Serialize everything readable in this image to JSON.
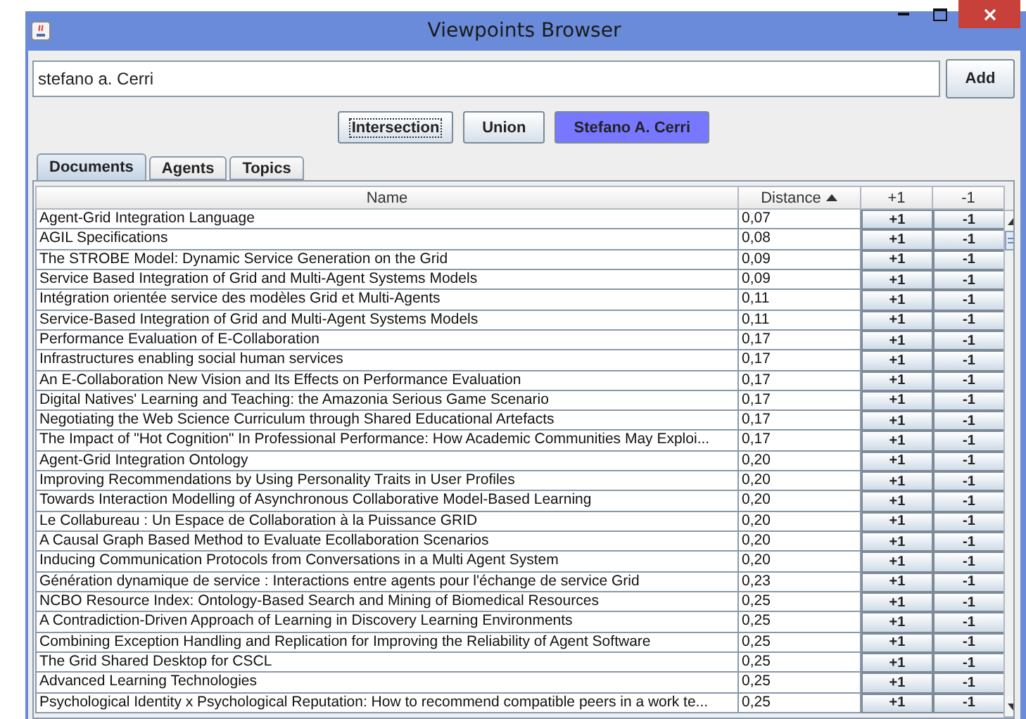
{
  "window": {
    "title": "Viewpoints Browser"
  },
  "search": {
    "value": "stefano a. Cerri",
    "button": "Add"
  },
  "modes": [
    {
      "label": "Intersection",
      "selected": false,
      "focused": true
    },
    {
      "label": "Union",
      "selected": false,
      "focused": false
    },
    {
      "label": "Stefano A. Cerri",
      "selected": true,
      "focused": false
    }
  ],
  "tabs": [
    {
      "label": "Documents",
      "selected": true
    },
    {
      "label": "Agents",
      "selected": false
    },
    {
      "label": "Topics",
      "selected": false
    }
  ],
  "table": {
    "columns": [
      {
        "label": "Name",
        "sorted": false
      },
      {
        "label": "Distance",
        "sorted": true
      },
      {
        "label": "+1",
        "sorted": false
      },
      {
        "label": "-1",
        "sorted": false
      }
    ],
    "rows": [
      {
        "name": "Agent-Grid Integration Language",
        "distance": "0,07",
        "up": "+1",
        "down": "-1"
      },
      {
        "name": "AGIL Specifications",
        "distance": "0,08",
        "up": "+1",
        "down": "-1"
      },
      {
        "name": "The STROBE Model: Dynamic Service Generation on the Grid",
        "distance": "0,09",
        "up": "+1",
        "down": "-1"
      },
      {
        "name": "Service Based Integration of Grid and Multi-Agent Systems Models",
        "distance": "0,09",
        "up": "+1",
        "down": "-1"
      },
      {
        "name": "Intégration orientée service des modèles Grid et Multi-Agents",
        "distance": "0,11",
        "up": "+1",
        "down": "-1"
      },
      {
        "name": "Service-Based Integration of Grid and Multi-Agent Systems Models",
        "distance": "0,11",
        "up": "+1",
        "down": "-1"
      },
      {
        "name": "Performance Evaluation of E-Collaboration",
        "distance": "0,17",
        "up": "+1",
        "down": "-1"
      },
      {
        "name": "Infrastructures enabling social human services",
        "distance": "0,17",
        "up": "+1",
        "down": "-1"
      },
      {
        "name": "An E-Collaboration New Vision and Its Effects on Performance Evaluation",
        "distance": "0,17",
        "up": "+1",
        "down": "-1"
      },
      {
        "name": "Digital Natives' Learning and Teaching: the Amazonia Serious Game Scenario",
        "distance": "0,17",
        "up": "+1",
        "down": "-1"
      },
      {
        "name": "Negotiating the Web Science Curriculum through Shared Educational Artefacts",
        "distance": "0,17",
        "up": "+1",
        "down": "-1"
      },
      {
        "name": "The Impact of \"Hot Cognition\" In Professional Performance: How Academic Communities May Exploi...",
        "distance": "0,17",
        "up": "+1",
        "down": "-1"
      },
      {
        "name": "Agent-Grid Integration Ontology",
        "distance": "0,20",
        "up": "+1",
        "down": "-1"
      },
      {
        "name": "Improving Recommendations by Using Personality Traits in User Profiles",
        "distance": "0,20",
        "up": "+1",
        "down": "-1"
      },
      {
        "name": "Towards Interaction Modelling of Asynchronous Collaborative Model-Based Learning",
        "distance": "0,20",
        "up": "+1",
        "down": "-1"
      },
      {
        "name": "Le Collabureau : Un Espace de Collaboration à la Puissance GRID",
        "distance": "0,20",
        "up": "+1",
        "down": "-1"
      },
      {
        "name": "A Causal Graph Based Method to Evaluate Ecollaboration Scenarios",
        "distance": "0,20",
        "up": "+1",
        "down": "-1"
      },
      {
        "name": "Inducing Communication Protocols from Conversations in a Multi Agent System",
        "distance": "0,20",
        "up": "+1",
        "down": "-1"
      },
      {
        "name": "Génération dynamique de service : Interactions entre agents pour l'échange de service Grid",
        "distance": "0,23",
        "up": "+1",
        "down": "-1"
      },
      {
        "name": "NCBO Resource Index: Ontology-Based Search and Mining of Biomedical Resources",
        "distance": "0,25",
        "up": "+1",
        "down": "-1"
      },
      {
        "name": "A Contradiction-Driven Approach of Learning in Discovery Learning Environments",
        "distance": "0,25",
        "up": "+1",
        "down": "-1"
      },
      {
        "name": "Combining Exception Handling and Replication for Improving the Reliability of Agent Software",
        "distance": "0,25",
        "up": "+1",
        "down": "-1"
      },
      {
        "name": "The Grid Shared Desktop for CSCL",
        "distance": "0,25",
        "up": "+1",
        "down": "-1"
      },
      {
        "name": "Advanced Learning Technologies",
        "distance": "0,25",
        "up": "+1",
        "down": "-1"
      },
      {
        "name": "Psychological Identity x Psychological Reputation: How to recommend compatible peers in a work te...",
        "distance": "0,25",
        "up": "+1",
        "down": "-1"
      }
    ]
  }
}
